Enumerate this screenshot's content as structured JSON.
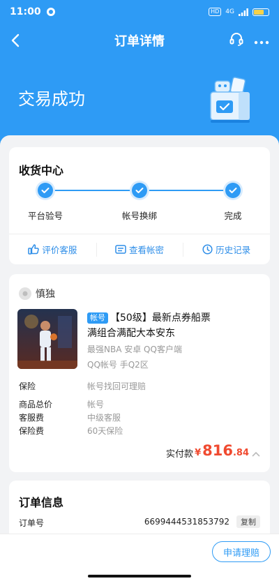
{
  "status_bar": {
    "time": "11:00",
    "network": "4G",
    "hd": "HD"
  },
  "nav": {
    "title": "订单详情"
  },
  "hero": {
    "status": "交易成功"
  },
  "receive": {
    "title": "收货中心",
    "steps": [
      "平台验号",
      "帐号换绑",
      "完成"
    ],
    "actions": [
      {
        "label": "评价客服",
        "icon": "thumbs-up-icon"
      },
      {
        "label": "查看帐密",
        "icon": "id-card-icon"
      },
      {
        "label": "历史记录",
        "icon": "clock-icon"
      }
    ]
  },
  "goods": {
    "shop_name": "慎独",
    "badge": "帐号",
    "title": "【50级】最新点券船票满组合满配大本安东",
    "meta_line1": "最强NBA  安卓  QQ客户端",
    "meta_line2": "QQ帐号  手Q2区",
    "rows": [
      {
        "label": "保险",
        "value": "帐号找回可理赔"
      },
      {
        "label": "商品总价",
        "value": "帐号"
      },
      {
        "label": "客服费",
        "value": "中级客服"
      },
      {
        "label": "保险费",
        "value": "60天保险"
      }
    ],
    "pay_label": "实付款",
    "currency": "¥",
    "amount_int": "816",
    "amount_dec": ".84"
  },
  "order": {
    "title": "订单信息",
    "no_label": "订单号",
    "no_value": "6699444531853792",
    "copy_label": "复制"
  },
  "bottom": {
    "claim_label": "申请理赔"
  },
  "colors": {
    "brand_blue": "#2e9bf5",
    "price_red": "#f04a30"
  }
}
